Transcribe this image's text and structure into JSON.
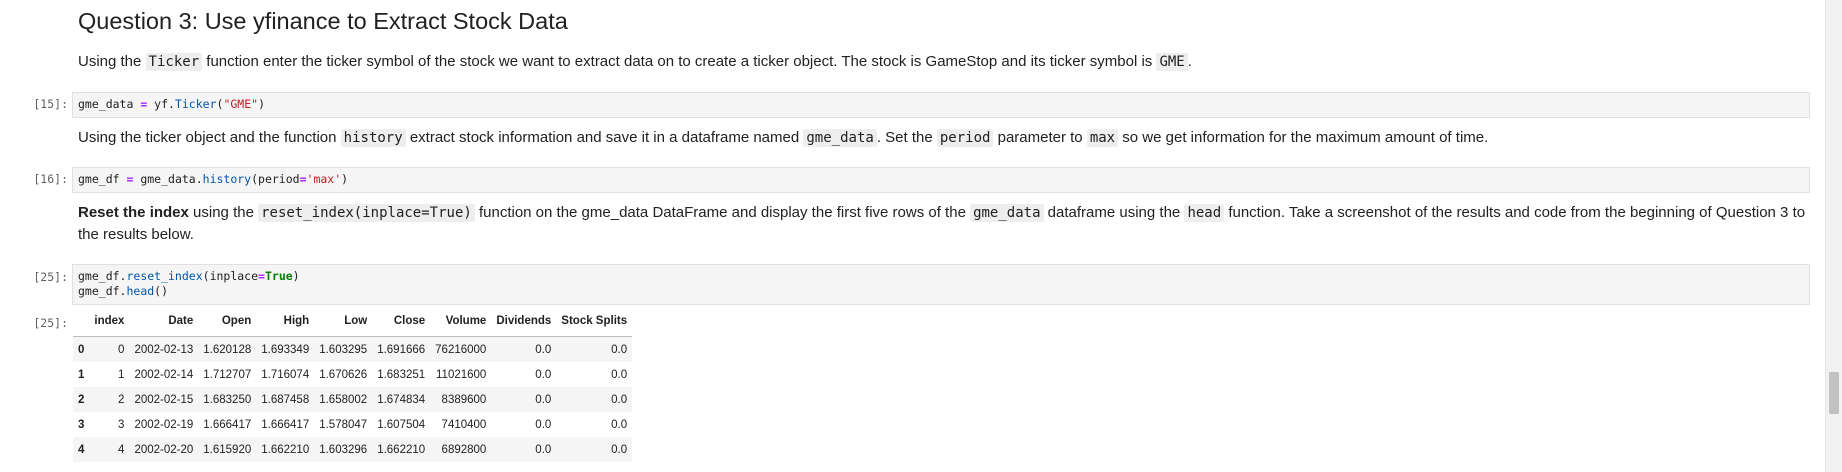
{
  "heading": "Question 3: Use yfinance to Extract Stock Data",
  "md1": {
    "t1": "Using the ",
    "c1": "Ticker",
    "t2": " function enter the ticker symbol of the stock we want to extract data on to create a ticker object. The stock is GameStop and its ticker symbol is ",
    "c2": "GME",
    "t3": "."
  },
  "cell15": {
    "prompt": "[15]:",
    "var": "gme_data",
    "eq": " = ",
    "obj": "yf.",
    "fn": "Ticker",
    "open": "(",
    "arg": "\"GME\"",
    "close": ")"
  },
  "md2": {
    "t1": "Using the ticker object and the function ",
    "c1": "history",
    "t2": " extract stock information and save it in a dataframe named ",
    "c2": "gme_data",
    "t3": ". Set the ",
    "c3": "period",
    "t4": " parameter to ",
    "c4": "max",
    "t5": " so we get information for the maximum amount of time."
  },
  "cell16": {
    "prompt": "[16]:",
    "var": "gme_df",
    "eq": " = ",
    "obj": "gme_data.",
    "fn": "history",
    "open": "(period",
    "eq2": "=",
    "arg": "'max'",
    "close": ")"
  },
  "md3": {
    "bold": "Reset the index",
    "t1": " using the ",
    "c1": "reset_index(inplace=True)",
    "t2": " function on the gme_data DataFrame and display the first five rows of the ",
    "c2": "gme_data",
    "t3": " dataframe using the ",
    "c3": "head",
    "t4": " function. Take a screenshot of the results and code from the beginning of Question 3 to the results below."
  },
  "cell25": {
    "prompt": "[25]:",
    "l1_obj": "gme_df.",
    "l1_fn": "reset_index",
    "l1_open": "(inplace",
    "l1_eq": "=",
    "l1_kw": "True",
    "l1_close": ")",
    "l2_obj": "gme_df.",
    "l2_fn": "head",
    "l2_close": "()"
  },
  "out25": {
    "prompt": "[25]:",
    "columns": [
      "",
      "index",
      "Date",
      "Open",
      "High",
      "Low",
      "Close",
      "Volume",
      "Dividends",
      "Stock Splits"
    ],
    "rows": [
      [
        "0",
        "0",
        "2002-02-13",
        "1.620128",
        "1.693349",
        "1.603295",
        "1.691666",
        "76216000",
        "0.0",
        "0.0"
      ],
      [
        "1",
        "1",
        "2002-02-14",
        "1.712707",
        "1.716074",
        "1.670626",
        "1.683251",
        "11021600",
        "0.0",
        "0.0"
      ],
      [
        "2",
        "2",
        "2002-02-15",
        "1.683250",
        "1.687458",
        "1.658002",
        "1.674834",
        "8389600",
        "0.0",
        "0.0"
      ],
      [
        "3",
        "3",
        "2002-02-19",
        "1.666417",
        "1.666417",
        "1.578047",
        "1.607504",
        "7410400",
        "0.0",
        "0.0"
      ],
      [
        "4",
        "4",
        "2002-02-20",
        "1.615920",
        "1.662210",
        "1.603296",
        "1.662210",
        "6892800",
        "0.0",
        "0.0"
      ]
    ]
  }
}
